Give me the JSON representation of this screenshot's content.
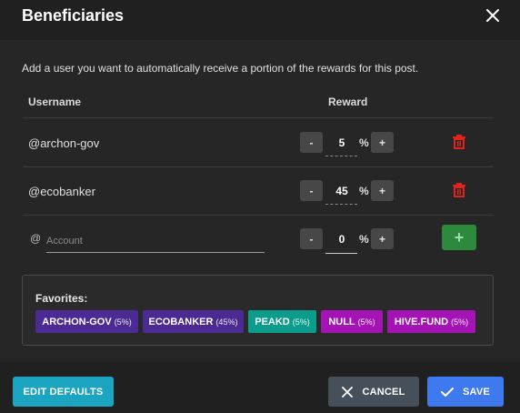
{
  "dialog": {
    "title": "Beneficiaries",
    "intro": "Add a user you want to automatically receive a portion of the rewards for this post."
  },
  "table": {
    "col_username": "Username",
    "col_reward": "Reward",
    "rows": [
      {
        "username": "@archon-gov",
        "reward": "5",
        "unit": "%"
      },
      {
        "username": "@ecobanker",
        "reward": "45",
        "unit": "%"
      }
    ]
  },
  "new_row": {
    "at_symbol": "@",
    "placeholder": "Account",
    "reward": "0",
    "unit": "%"
  },
  "stepper": {
    "minus": "-",
    "plus": "+"
  },
  "add_button_label": "+",
  "favorites": {
    "title": "Favorites:",
    "items": [
      {
        "name": "ARCHON-GOV",
        "percent": "(5%)",
        "color": "#4b2a93"
      },
      {
        "name": "ECOBANKER",
        "percent": "(45%)",
        "color": "#4b2a93"
      },
      {
        "name": "PEAKD",
        "percent": "(5%)",
        "color": "#0b9c8c"
      },
      {
        "name": "NULL",
        "percent": "(5%)",
        "color": "#a414b5"
      },
      {
        "name": "HIVE.FUND",
        "percent": "(5%)",
        "color": "#a414b5"
      }
    ]
  },
  "footer": {
    "edit_defaults": "EDIT DEFAULTS",
    "cancel": "CANCEL",
    "save": "SAVE"
  },
  "colors": {
    "delete_red": "#e0241c",
    "add_green": "#2d8a3c",
    "save_blue": "#3f79ee",
    "edit_teal": "#1ba5c0"
  }
}
